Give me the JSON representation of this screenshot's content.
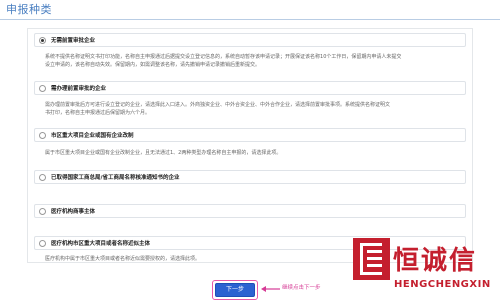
{
  "page": {
    "title": "申报种类"
  },
  "options": [
    {
      "label": "无需前置审批企业",
      "checked": true,
      "desc": [
        "系统不提供名称证明文书打印功能，名称自主申报通过后据提交设立登记信息的，系统自动暂存该申请记录；开展保证该名称10个工作日，保留期内申请人未提交",
        "设立申请的，该名称自动失效。保留期内，如需调整该名称，请先撤销申请记录撤销后重新提交。"
      ]
    },
    {
      "label": "需办理前置审批的企业",
      "checked": false,
      "desc": [
        "需办理前置审批后方可进行设立登记的企业，请选择此入口进入。外商独资企业、中外合资企业、中外合作企业，请选择前置审批事项。系统提供名称证明文",
        "书打印，名称自主申报通过后保留期为六个月。"
      ]
    },
    {
      "label": "市区重大项目企业或国有企业改制",
      "checked": false,
      "desc": [
        "属于市区重大项目企业或国有企业改制企业，且无法通过1、2两种类型办理名称自主申报的，请选择此项。"
      ]
    },
    {
      "label": "已取得国家工商总局/省工商局名称核准通知书的企业",
      "checked": false,
      "desc": []
    },
    {
      "label": "医疗机构商事主体",
      "checked": false,
      "desc": []
    },
    {
      "label": "医疗机构市区重大项目或者名称近似主体",
      "checked": false,
      "desc": [
        "医疗机构中属于市区重大项目或者名称近似需要授权的，请选择此项。"
      ]
    }
  ],
  "actions": {
    "next_label": "下一步",
    "hint": "继续点击下一步"
  },
  "logo": {
    "cn": "恒诚信",
    "en": "HENGCHENGXIN",
    "color": "#c41f2e"
  },
  "colors": {
    "accent": "#2b62d1",
    "title": "#4a7fc1",
    "hint": "#d63a95"
  }
}
